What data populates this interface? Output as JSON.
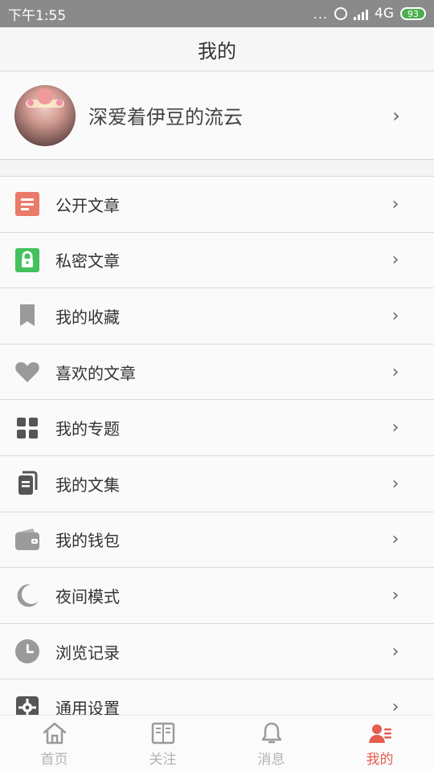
{
  "status_bar": {
    "time": "下午1:55",
    "dots": "...",
    "network": "4G",
    "battery": "93"
  },
  "page": {
    "title": "我的"
  },
  "profile": {
    "name": "深爱着伊豆的流云"
  },
  "menu": {
    "items": [
      {
        "label": "公开文章",
        "icon": "public-article-icon"
      },
      {
        "label": "私密文章",
        "icon": "private-article-icon"
      },
      {
        "label": "我的收藏",
        "icon": "bookmark-icon"
      },
      {
        "label": "喜欢的文章",
        "icon": "heart-icon"
      },
      {
        "label": "我的专题",
        "icon": "grid-icon"
      },
      {
        "label": "我的文集",
        "icon": "collection-icon"
      },
      {
        "label": "我的钱包",
        "icon": "wallet-icon"
      },
      {
        "label": "夜间模式",
        "icon": "moon-icon"
      },
      {
        "label": "浏览记录",
        "icon": "clock-icon"
      },
      {
        "label": "通用设置",
        "icon": "gear-icon"
      }
    ]
  },
  "bottom_nav": {
    "items": [
      {
        "label": "首页",
        "icon": "home-icon"
      },
      {
        "label": "关注",
        "icon": "book-icon"
      },
      {
        "label": "消息",
        "icon": "bell-icon"
      },
      {
        "label": "我的",
        "icon": "profile-icon",
        "active": true
      }
    ]
  },
  "colors": {
    "accent": "#e45d4f",
    "public_icon": "#ea7a69",
    "private_icon": "#43c15d",
    "gray_icon": "#9a9a9a",
    "dark_icon": "#555555"
  }
}
